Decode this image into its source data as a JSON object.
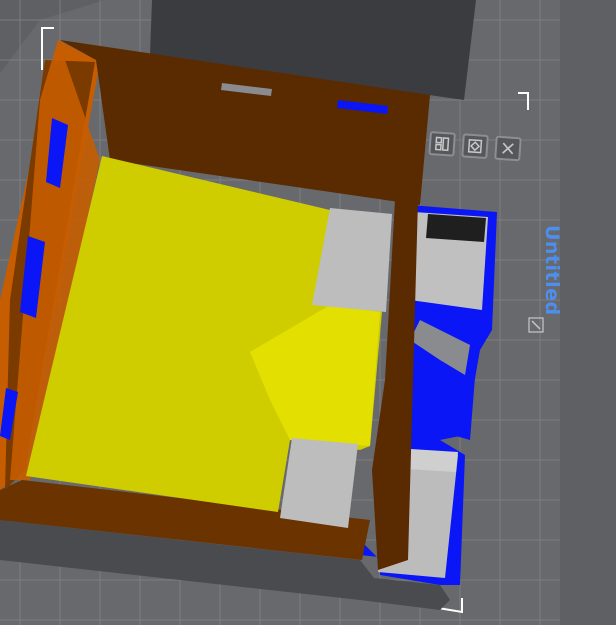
{
  "plate": {
    "name": "Untitled",
    "edit_icon": "pencil-edit-icon"
  },
  "toolbar": {
    "buttons": [
      {
        "icon": "arrange-icon",
        "label": ""
      },
      {
        "icon": "orient-icon",
        "label": ""
      },
      {
        "icon": "close-icon",
        "label": ""
      }
    ]
  },
  "colors": {
    "background": "#5f6063",
    "bed": "#68696c",
    "grid_line": "#7c7d80",
    "selected_highlight": "#0a16f5",
    "model_brown": "#5a2a00",
    "model_orange": "#c65d00",
    "model_yellow": "#dcd800",
    "model_grey": "#b4b4b4",
    "accent": "#4c8ff0"
  }
}
